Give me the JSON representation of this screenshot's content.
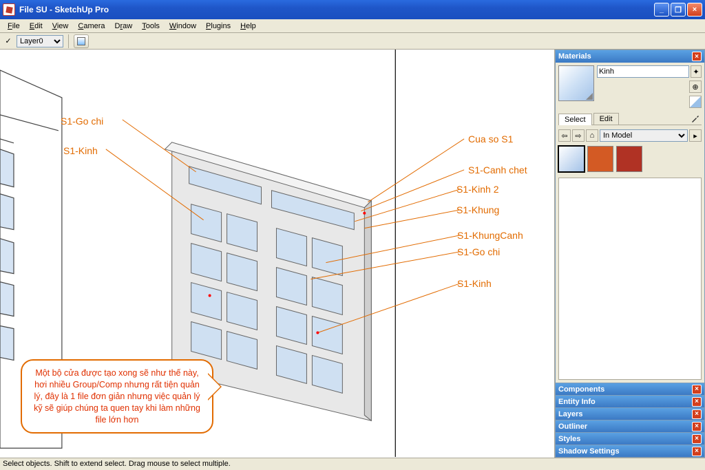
{
  "window": {
    "title": "File SU - SketchUp Pro"
  },
  "menu": {
    "items": [
      "File",
      "Edit",
      "View",
      "Camera",
      "Draw",
      "Tools",
      "Window",
      "Plugins",
      "Help"
    ]
  },
  "toolbar": {
    "layer": "Layer0"
  },
  "status": {
    "text": "Select objects. Shift to extend select. Drag mouse to select multiple."
  },
  "materials": {
    "title": "Materials",
    "name": "Kinh",
    "tabs": [
      "Select",
      "Edit"
    ],
    "library": "In Model",
    "swatches": [
      {
        "color": "linear-gradient(135deg,#ffffff,#a3c2e8)",
        "selected": true
      },
      {
        "color": "#d35a24",
        "selected": false
      },
      {
        "color": "#b03224",
        "selected": false
      }
    ]
  },
  "panels": [
    "Components",
    "Entity Info",
    "Layers",
    "Outliner",
    "Styles",
    "Shadow Settings"
  ],
  "annotations": {
    "left": [
      "S1-Go chi",
      "S1-Kinh"
    ],
    "right": [
      "Cua so S1",
      "S1-Canh chet",
      "S1-Kinh 2",
      "S1-Khung",
      "S1-KhungCanh",
      "S1-Go chi",
      "S1-Kinh"
    ]
  },
  "callout": "Một bộ cửa được tạo xong sẽ như thế này, hơi nhiều Group/Comp nhưng rất tiện quản lý, đây là 1 file đơn giản nhưng việc quản lý kỹ sẽ giúp chúng ta quen tay khi làm những file lớn hơn"
}
